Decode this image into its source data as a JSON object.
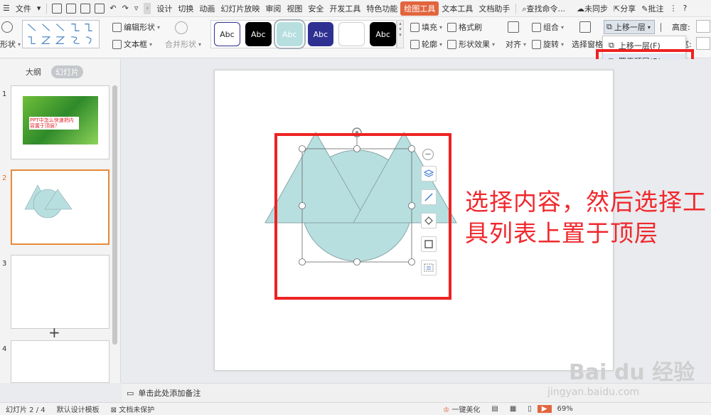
{
  "menu": {
    "file": "文件",
    "tabs": [
      "设计",
      "切换",
      "动画",
      "幻灯片放映",
      "审阅",
      "视图",
      "安全",
      "开发工具",
      "特色功能"
    ],
    "active_tab": "绘图工具",
    "tabs_after": [
      "文本工具",
      "文档助手"
    ],
    "search": "查找命令...",
    "sync": "未同步",
    "share": "分享",
    "comment": "批注",
    "help": "?"
  },
  "ribbon": {
    "shape_label": "形状",
    "edit_shape": "编辑形状",
    "textbox": "文本框",
    "merge_shape": "合并形状",
    "style_samples": [
      "Abc",
      "Abc",
      "Abc",
      "Abc",
      "",
      "Abc"
    ],
    "style_colors": [
      "#ffffff",
      "#000000",
      "#b8dfe0",
      "#2f3192",
      "#ffffff",
      "#000000"
    ],
    "fill": "填充",
    "format_brush": "格式刷",
    "outline": "轮廓",
    "shape_effects": "形状效果",
    "align": "对齐",
    "group": "组合",
    "rotate": "旋转",
    "selection_pane": "选择窗格",
    "bring_forward": "上移一层",
    "height_label": "高度:",
    "width_label": "宽:"
  },
  "dropdown": {
    "items": [
      "上移一层(F)",
      "置于顶层(R)"
    ]
  },
  "left_panel": {
    "tab_outline": "大纲",
    "tab_slides": "幻灯片",
    "slide_numbers": [
      "1",
      "2",
      "3",
      "4"
    ],
    "slide1_title": "PPT中怎么快速把内容置于顶层？",
    "add_slide": "+"
  },
  "annotation": "选择内容，然后选择工具列表上置于顶层",
  "notes_placeholder": "单击此处添加备注",
  "status": {
    "slide_info": "幻灯片 2 / 4",
    "template": "默认设计模板",
    "protect": "文档未保护",
    "beautify": "一键美化",
    "zoom": "69%"
  },
  "watermark": {
    "brand": "Bai du 经验",
    "url": "jingyan.baidu.com"
  },
  "colors": {
    "shape_fill": "#b8dfe0",
    "shape_stroke": "#8aa6a8",
    "active_tab": "#e2653e",
    "annotation": "#f0282d",
    "highlight_box": "#ee2222"
  }
}
